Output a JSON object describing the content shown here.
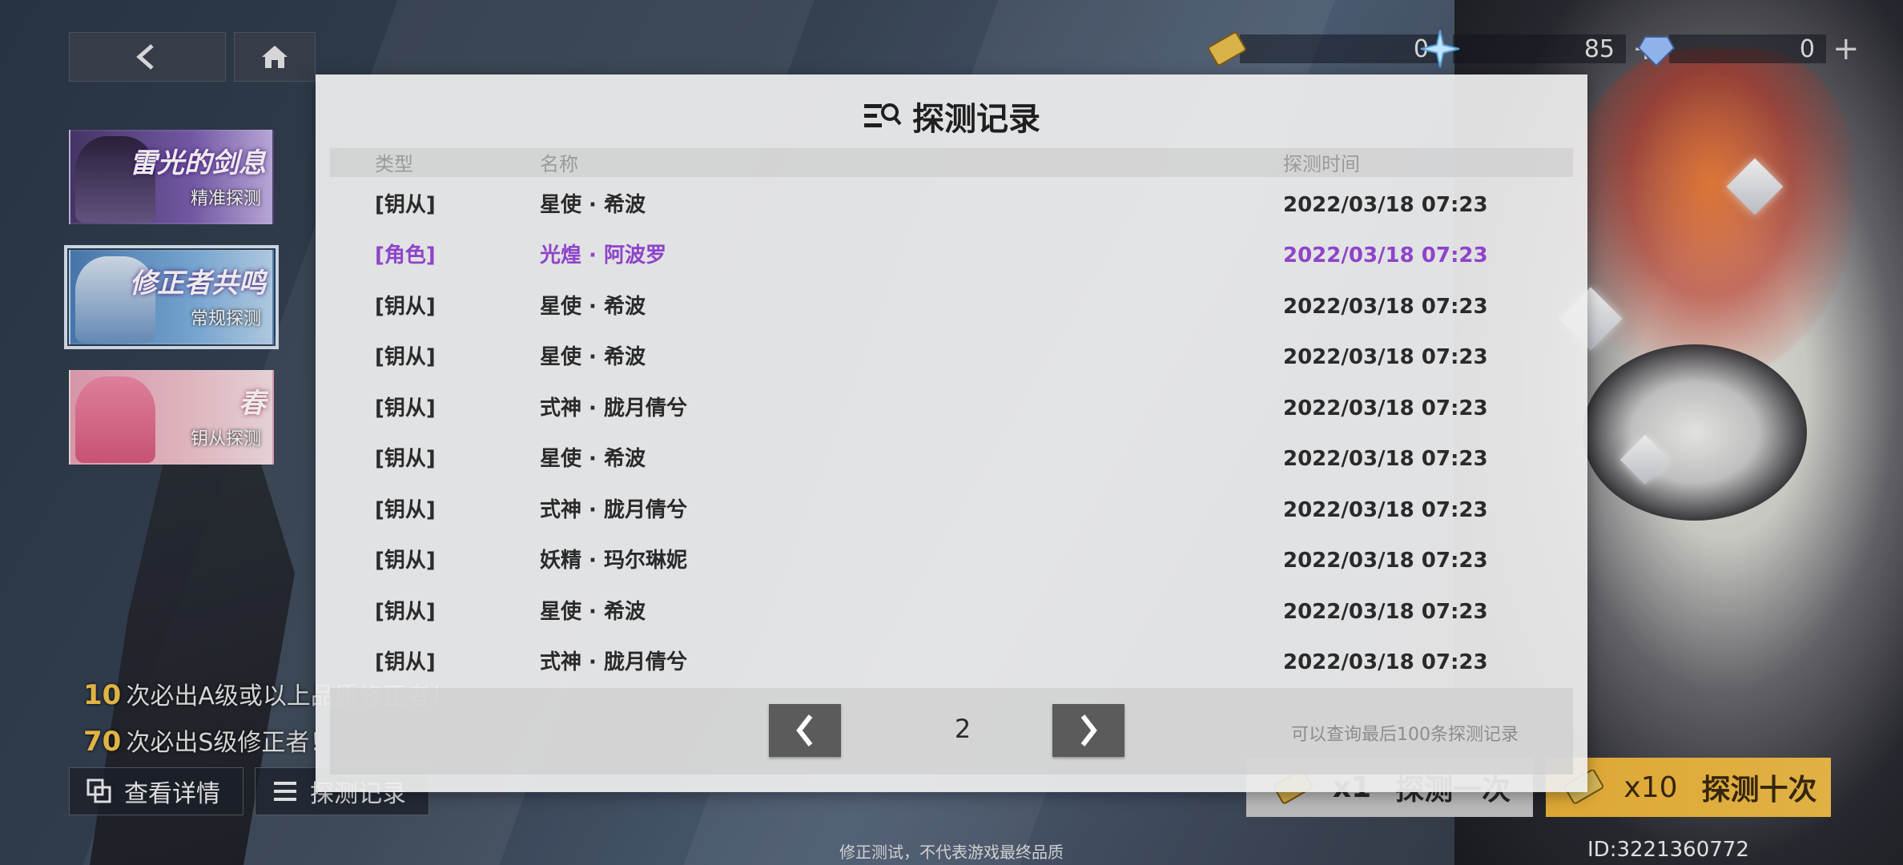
{
  "currencies": [
    {
      "name": "gold-ticket-icon",
      "value": "0",
      "plus": ""
    },
    {
      "name": "crystal-star-icon",
      "value": "85",
      "plus": "+"
    },
    {
      "name": "blue-crystal-icon",
      "value": "0",
      "plus": "+"
    }
  ],
  "banners": [
    {
      "title": "雷光的剑息",
      "subtitle": "精准探测"
    },
    {
      "title": "修正者共鸣",
      "subtitle": "常规探测"
    },
    {
      "title": "春",
      "subtitle": "钥从探测"
    }
  ],
  "pity": [
    {
      "count": "10",
      "text": "次必出A级或以上品质修正者！"
    },
    {
      "count": "70",
      "text": "次必出S级修正者！"
    }
  ],
  "bottom_buttons": {
    "details": "查看详情",
    "records": "探测记录"
  },
  "pull_buttons": {
    "single_count": "x1",
    "single_label": "探测一次",
    "ten_count": "x10",
    "ten_label": "探测十次"
  },
  "modal": {
    "title": "探测记录",
    "headers": {
      "type": "类型",
      "name": "名称",
      "time": "探测时间"
    },
    "rows": [
      {
        "type": "[钥从]",
        "name": "星使 · 希波",
        "time": "2022/03/18 07:23"
      },
      {
        "type": "[角色]",
        "name": "光煌 · 阿波罗",
        "time": "2022/03/18 07:23"
      },
      {
        "type": "[钥从]",
        "name": "星使 · 希波",
        "time": "2022/03/18 07:23"
      },
      {
        "type": "[钥从]",
        "name": "星使 · 希波",
        "time": "2022/03/18 07:23"
      },
      {
        "type": "[钥从]",
        "name": "式神 · 胧月倩兮",
        "time": "2022/03/18 07:23"
      },
      {
        "type": "[钥从]",
        "name": "星使 · 希波",
        "time": "2022/03/18 07:23"
      },
      {
        "type": "[钥从]",
        "name": "式神 · 胧月倩兮",
        "time": "2022/03/18 07:23"
      },
      {
        "type": "[钥从]",
        "name": "妖精 · 玛尔琳妮",
        "time": "2022/03/18 07:23"
      },
      {
        "type": "[钥从]",
        "name": "星使 · 希波",
        "time": "2022/03/18 07:23"
      },
      {
        "type": "[钥从]",
        "name": "式神 · 胧月倩兮",
        "time": "2022/03/18 07:23"
      }
    ],
    "page": "2",
    "note": "可以查询最后100条探测记录"
  },
  "footer_note": "修正测试，不代表游戏最终品质",
  "uid": "ID:3221360772",
  "colors": {
    "highlight_purple": "#8e44c9",
    "accent_gold": "#f3c44a",
    "pull_ten_bg": "#f0b63a"
  }
}
